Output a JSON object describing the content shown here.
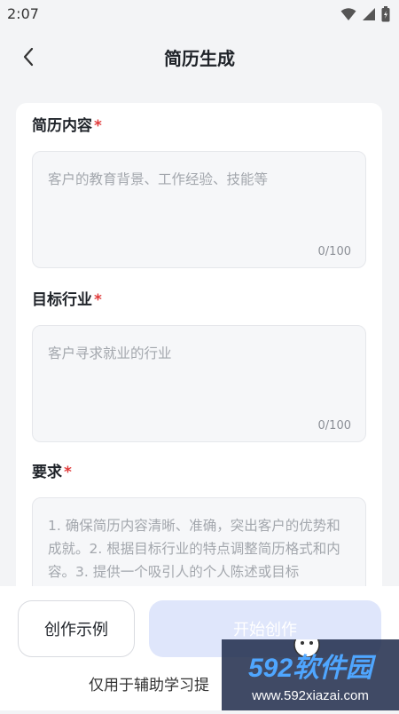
{
  "status_bar": {
    "time": "2:07"
  },
  "header": {
    "title": "简历生成"
  },
  "form": {
    "resume_content": {
      "label": "简历内容",
      "required_mark": "*",
      "placeholder": "客户的教育背景、工作经验、技能等",
      "counter": "0/100"
    },
    "target_industry": {
      "label": "目标行业",
      "required_mark": "*",
      "placeholder": "客户寻求就业的行业",
      "counter": "0/100"
    },
    "requirements": {
      "label": "要求",
      "required_mark": "*",
      "placeholder": "1. 确保简历内容清晰、准确，突出客户的优势和成就。2. 根据目标行业的特点调整简历格式和内容。3. 提供一个吸引人的个人陈述或目标"
    }
  },
  "actions": {
    "example_label": "创作示例",
    "start_label": "开始创作"
  },
  "footer": {
    "disclaimer": "仅用于辅助学习提"
  },
  "watermark": {
    "brand": "592软件园",
    "url": "www.592xiazai.com"
  },
  "colors": {
    "page_bg": "#f3f4f6",
    "card_bg": "#ffffff",
    "required": "#e03a3a",
    "start_button_bg": "#dfe6fb",
    "placeholder": "#a3a7ad"
  }
}
